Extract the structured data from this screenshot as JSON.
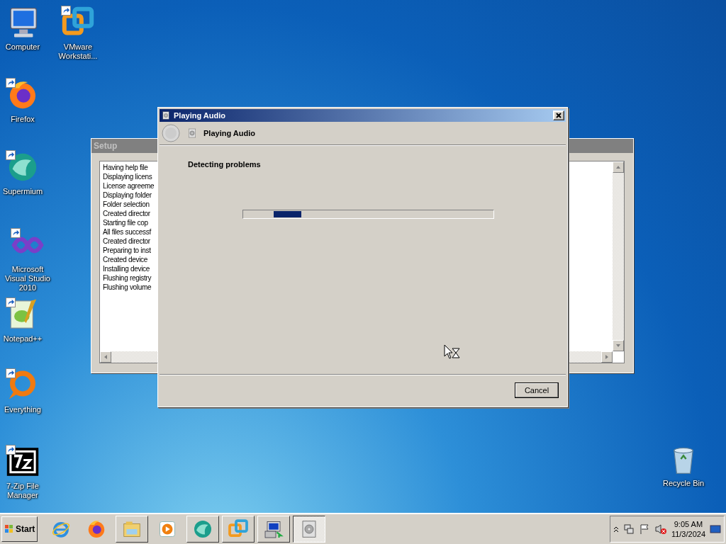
{
  "desktop_icons": [
    {
      "label": "Computer",
      "kind": "computer",
      "shortcut": false
    },
    {
      "label": "VMware Workstati...",
      "kind": "vmware",
      "shortcut": true
    },
    {
      "label": "Firefox",
      "kind": "firefox",
      "shortcut": true
    },
    {
      "label": "Supermium",
      "kind": "supermium",
      "shortcut": true
    },
    {
      "label": "Microsoft Visual Studio 2010",
      "kind": "vstudio",
      "shortcut": true
    },
    {
      "label": "Notepad++",
      "kind": "notepad",
      "shortcut": true
    },
    {
      "label": "Everything",
      "kind": "everything",
      "shortcut": true
    },
    {
      "label": "7-Zip File Manager",
      "kind": "sevenzip",
      "shortcut": true
    },
    {
      "label": "Recycle Bin",
      "kind": "recycle",
      "shortcut": false
    }
  ],
  "setup_window": {
    "title": "Setup",
    "log": [
      "Having help file",
      "Displaying licens",
      "License agreeme",
      "Displaying folder",
      "Folder selection",
      "Created director",
      "Starting file cop",
      "All files successf",
      "Created director",
      "Preparing to inst",
      "Created device",
      "Installing device",
      "Flushing registry",
      "Flushing volume"
    ]
  },
  "dialog": {
    "title": "Playing Audio",
    "header": "Playing Audio",
    "status": "Detecting problems",
    "level": 0.11,
    "buttons": [
      "Cancel"
    ]
  },
  "taskbar": {
    "start": "Start",
    "items": [
      {
        "kind": "ie",
        "running": false,
        "selected": false
      },
      {
        "kind": "firefox",
        "running": false,
        "selected": false
      },
      {
        "kind": "explorer",
        "running": true,
        "selected": false
      },
      {
        "kind": "media",
        "running": false,
        "selected": false
      },
      {
        "kind": "supermium",
        "running": true,
        "selected": false
      },
      {
        "kind": "vmware",
        "running": true,
        "selected": false
      },
      {
        "kind": "setup",
        "running": true,
        "selected": false
      },
      {
        "kind": "audio",
        "running": true,
        "selected": true
      }
    ],
    "time": "9:05 AM",
    "date": "11/3/2024"
  }
}
